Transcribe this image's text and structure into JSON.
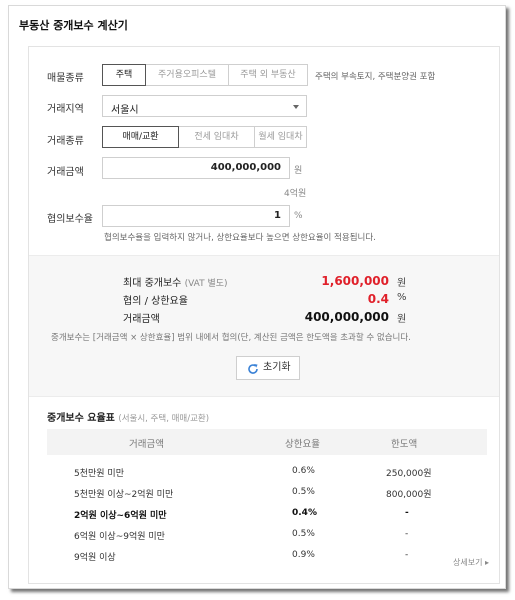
{
  "app": {
    "title": "부동산 중개보수 계산기"
  },
  "form": {
    "property_type": {
      "label": "매물종류",
      "options": [
        "주택",
        "주거용오피스텔",
        "주택 외 부동산"
      ],
      "selected": "주택",
      "note": "주택의 부속토지, 주택분양권 포함"
    },
    "region": {
      "label": "거래지역",
      "value": "서울시"
    },
    "trade_type": {
      "label": "거래종류",
      "options": [
        "매매/교환",
        "전세 임대차",
        "월세 임대차"
      ],
      "selected": "매매/교환"
    },
    "amount": {
      "label": "거래금액",
      "value": "400,000,000",
      "unit": "원",
      "hint": "4억원"
    },
    "rate": {
      "label": "협의보수율",
      "value": "1",
      "unit": "%",
      "note": "협의보수율을 입력하지 않거나, 상한요율보다 높으면 상한요율이 적용됩니다."
    }
  },
  "result": {
    "rows": [
      {
        "label": "최대 중개보수",
        "label_sub": "(VAT 별도)",
        "value": "1,600,000",
        "unit": "원",
        "emphasis": "red"
      },
      {
        "label": "협의 / 상한요율",
        "label_sub": "",
        "value": "0.4",
        "unit": "%",
        "emphasis": "red"
      },
      {
        "label": "거래금액",
        "label_sub": "",
        "value": "400,000,000",
        "unit": "원",
        "emphasis": "dark"
      }
    ],
    "disclaimer": "중개보수는 [거래금액 × 상한효율] 범위 내에서 협의(단, 계산된 금액은 한도액을 초과할 수 없습니다.",
    "reset_label": "초기화"
  },
  "rate_table": {
    "title": "중개보수 요율표",
    "subtitle": "(서울시, 주택, 매매/교환)",
    "columns": [
      "거래금액",
      "상한요율",
      "한도액"
    ],
    "rows": [
      {
        "range": "5천만원 미만",
        "rate": "0.6%",
        "limit": "250,000원",
        "highlight": false
      },
      {
        "range": "5천만원 이상~2억원 미만",
        "rate": "0.5%",
        "limit": "800,000원",
        "highlight": false
      },
      {
        "range": "2억원 이상~6억원 미만",
        "rate": "0.4%",
        "limit": "-",
        "highlight": true
      },
      {
        "range": "6억원 이상~9억원 미만",
        "rate": "0.5%",
        "limit": "-",
        "highlight": false
      },
      {
        "range": "9억원 이상",
        "rate": "0.9%",
        "limit": "-",
        "highlight": false
      }
    ],
    "more_label": "상세보기 ▸"
  },
  "colors": {
    "accent_red": "#e0202a",
    "refresh_icon": "#3b82d6"
  }
}
